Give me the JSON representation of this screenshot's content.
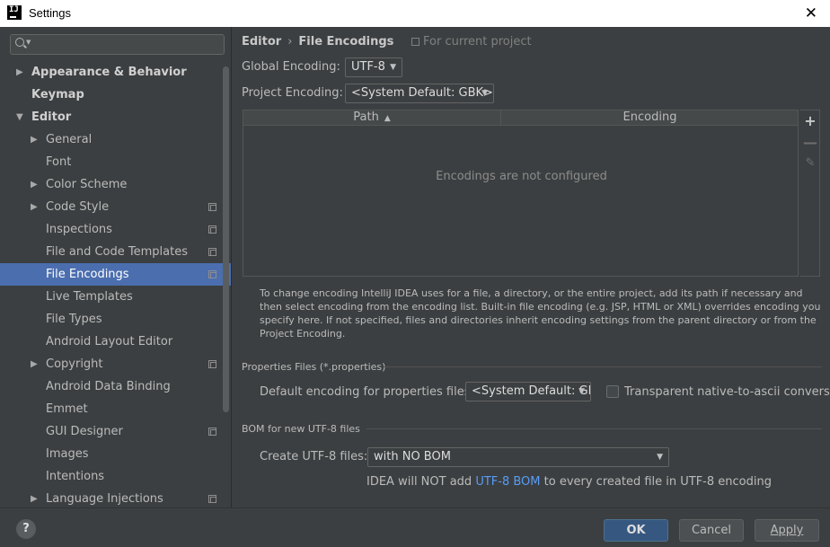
{
  "window": {
    "title": "Settings",
    "app_icon_text": "IJ",
    "close_glyph": "✕"
  },
  "sidebar": {
    "search_placeholder": "",
    "items": [
      {
        "label": "Appearance & Behavior",
        "level": 0,
        "arrow": "▶",
        "bold": true,
        "project_icon": false,
        "selected": false
      },
      {
        "label": "Keymap",
        "level": 0,
        "arrow": "",
        "bold": true,
        "project_icon": false,
        "selected": false
      },
      {
        "label": "Editor",
        "level": 0,
        "arrow": "▼",
        "bold": true,
        "project_icon": false,
        "selected": false
      },
      {
        "label": "General",
        "level": 1,
        "arrow": "▶",
        "bold": false,
        "project_icon": false,
        "selected": false
      },
      {
        "label": "Font",
        "level": 1,
        "arrow": "",
        "bold": false,
        "project_icon": false,
        "selected": false
      },
      {
        "label": "Color Scheme",
        "level": 1,
        "arrow": "▶",
        "bold": false,
        "project_icon": false,
        "selected": false
      },
      {
        "label": "Code Style",
        "level": 1,
        "arrow": "▶",
        "bold": false,
        "project_icon": true,
        "selected": false
      },
      {
        "label": "Inspections",
        "level": 1,
        "arrow": "",
        "bold": false,
        "project_icon": true,
        "selected": false
      },
      {
        "label": "File and Code Templates",
        "level": 1,
        "arrow": "",
        "bold": false,
        "project_icon": true,
        "selected": false
      },
      {
        "label": "File Encodings",
        "level": 1,
        "arrow": "",
        "bold": false,
        "project_icon": true,
        "selected": true
      },
      {
        "label": "Live Templates",
        "level": 1,
        "arrow": "",
        "bold": false,
        "project_icon": false,
        "selected": false
      },
      {
        "label": "File Types",
        "level": 1,
        "arrow": "",
        "bold": false,
        "project_icon": false,
        "selected": false
      },
      {
        "label": "Android Layout Editor",
        "level": 1,
        "arrow": "",
        "bold": false,
        "project_icon": false,
        "selected": false
      },
      {
        "label": "Copyright",
        "level": 1,
        "arrow": "▶",
        "bold": false,
        "project_icon": true,
        "selected": false
      },
      {
        "label": "Android Data Binding",
        "level": 1,
        "arrow": "",
        "bold": false,
        "project_icon": false,
        "selected": false
      },
      {
        "label": "Emmet",
        "level": 1,
        "arrow": "",
        "bold": false,
        "project_icon": false,
        "selected": false
      },
      {
        "label": "GUI Designer",
        "level": 1,
        "arrow": "",
        "bold": false,
        "project_icon": true,
        "selected": false
      },
      {
        "label": "Images",
        "level": 1,
        "arrow": "",
        "bold": false,
        "project_icon": false,
        "selected": false
      },
      {
        "label": "Intentions",
        "level": 1,
        "arrow": "",
        "bold": false,
        "project_icon": false,
        "selected": false
      },
      {
        "label": "Language Injections",
        "level": 1,
        "arrow": "▶",
        "bold": false,
        "project_icon": true,
        "selected": false
      }
    ]
  },
  "breadcrumb": {
    "parent": "Editor",
    "separator": "›",
    "current": "File Encodings",
    "scope_note": "For current project"
  },
  "encodings": {
    "global_label": "Global Encoding:",
    "global_value": "UTF-8",
    "project_label": "Project Encoding:",
    "project_value": "<System Default: GBK>"
  },
  "table": {
    "col_path": "Path",
    "col_encoding": "Encoding",
    "empty_message": "Encodings are not configured",
    "add_glyph": "+",
    "remove_glyph": "—",
    "edit_glyph": "✎"
  },
  "help_text": "To change encoding IntelliJ IDEA uses for a file, a directory, or the entire project, add its path if necessary and then select encoding from the encoding list. Built-in file encoding (e.g. JSP, HTML or XML) overrides encoding you specify here. If not specified, files and directories inherit encoding settings from the parent directory or from the Project Encoding.",
  "properties": {
    "section_title": "Properties Files (*.properties)",
    "default_label": "Default encoding for properties files:",
    "default_value": "<System Default: GBK>",
    "transparent_label": "Transparent native-to-ascii conversion",
    "transparent_checked": false
  },
  "bom": {
    "section_title": "BOM for new UTF-8 files",
    "create_label": "Create UTF-8 files:",
    "create_value": "with NO BOM",
    "note_prefix": "IDEA will NOT add ",
    "note_link": "UTF-8 BOM",
    "note_suffix": " to every created file in UTF-8 encoding"
  },
  "footer": {
    "help_glyph": "?",
    "ok_label": "OK",
    "cancel_label": "Cancel",
    "apply_label": "Apply"
  },
  "colors": {
    "background": "#3c3f41",
    "selection": "#4b6eaf",
    "ok_button": "#365880",
    "link": "#589df6"
  }
}
